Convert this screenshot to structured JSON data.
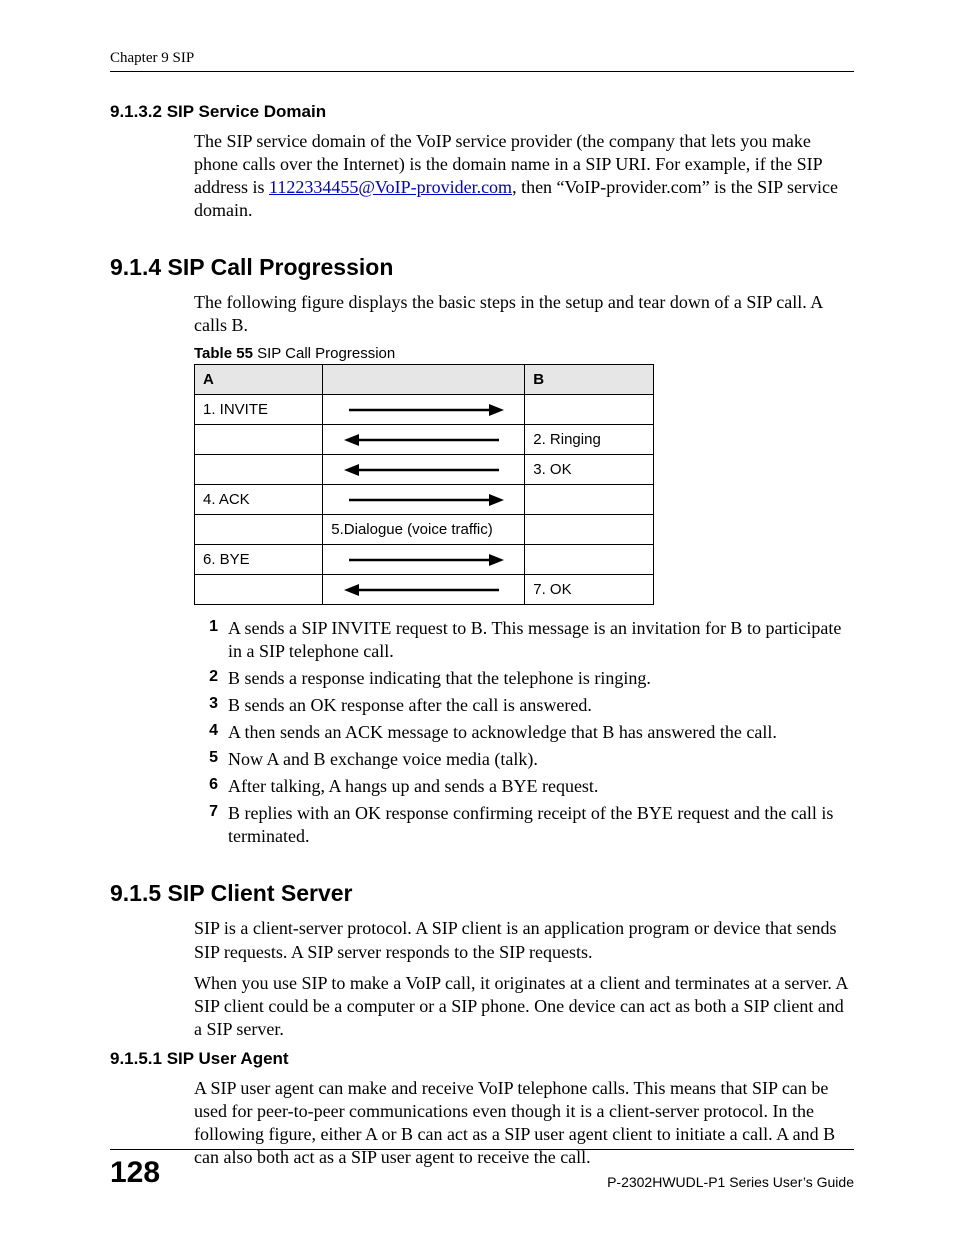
{
  "header": {
    "running": "Chapter 9 SIP"
  },
  "sec_9132": {
    "title": "9.1.3.2  SIP Service Domain",
    "p1a": "The SIP service domain of the VoIP service provider (the company that lets you make phone calls over the Internet) is the domain name in a SIP URI. For example, if the SIP address is ",
    "link": "1122334455@VoIP-provider.com",
    "p1b": ", then “VoIP-provider.com” is the SIP service domain."
  },
  "sec_914": {
    "title": "9.1.4  SIP Call Progression",
    "intro": "The following figure displays the basic steps in the setup and tear down of a SIP call. A calls B.",
    "table_label_bold": "Table 55",
    "table_label_rest": "   SIP Call Progression",
    "col_a": "A",
    "col_b": "B",
    "rows": [
      {
        "a": "1. INVITE",
        "dir": "right",
        "b": ""
      },
      {
        "a": "",
        "dir": "left",
        "b": "2. Ringing"
      },
      {
        "a": "",
        "dir": "left",
        "b": "3. OK"
      },
      {
        "a": "4. ACK",
        "dir": "right",
        "b": ""
      },
      {
        "a": "",
        "mid": "5.Dialogue (voice traffic)",
        "b": ""
      },
      {
        "a": "6. BYE",
        "dir": "right",
        "b": ""
      },
      {
        "a": "",
        "dir": "left",
        "b": "7. OK"
      }
    ],
    "steps": [
      "A sends a SIP INVITE request to B. This message is an invitation for B to participate in a SIP telephone call.",
      "B sends a response indicating that the telephone is ringing.",
      "B sends an OK response after the call is answered.",
      "A then sends an ACK message to acknowledge that B has answered the call.",
      "Now A and B exchange voice media (talk).",
      "After talking, A hangs up and sends a BYE request.",
      "B replies with an OK response confirming receipt of the BYE request and the call is terminated."
    ]
  },
  "sec_915": {
    "title": "9.1.5  SIP Client Server",
    "p1": "SIP is a client-server protocol. A SIP client is an application program or device that sends SIP requests. A SIP server responds to the SIP requests.",
    "p2": "When you use SIP to make a VoIP call, it originates at a client and terminates at a server. A SIP client could be a computer or a SIP phone. One device can act as both a SIP client and a SIP server."
  },
  "sec_9151": {
    "title": "9.1.5.1  SIP User Agent",
    "p1": "A SIP user agent can make and receive VoIP telephone calls. This means that SIP can be used for peer-to-peer communications even though it is a client-server protocol. In the following figure, either A or B can act as a SIP user agent client to initiate a call. A and B can also both act as a SIP user agent to receive the call."
  },
  "footer": {
    "page": "128",
    "guide": "P-2302HWUDL-P1 Series User’s Guide"
  }
}
